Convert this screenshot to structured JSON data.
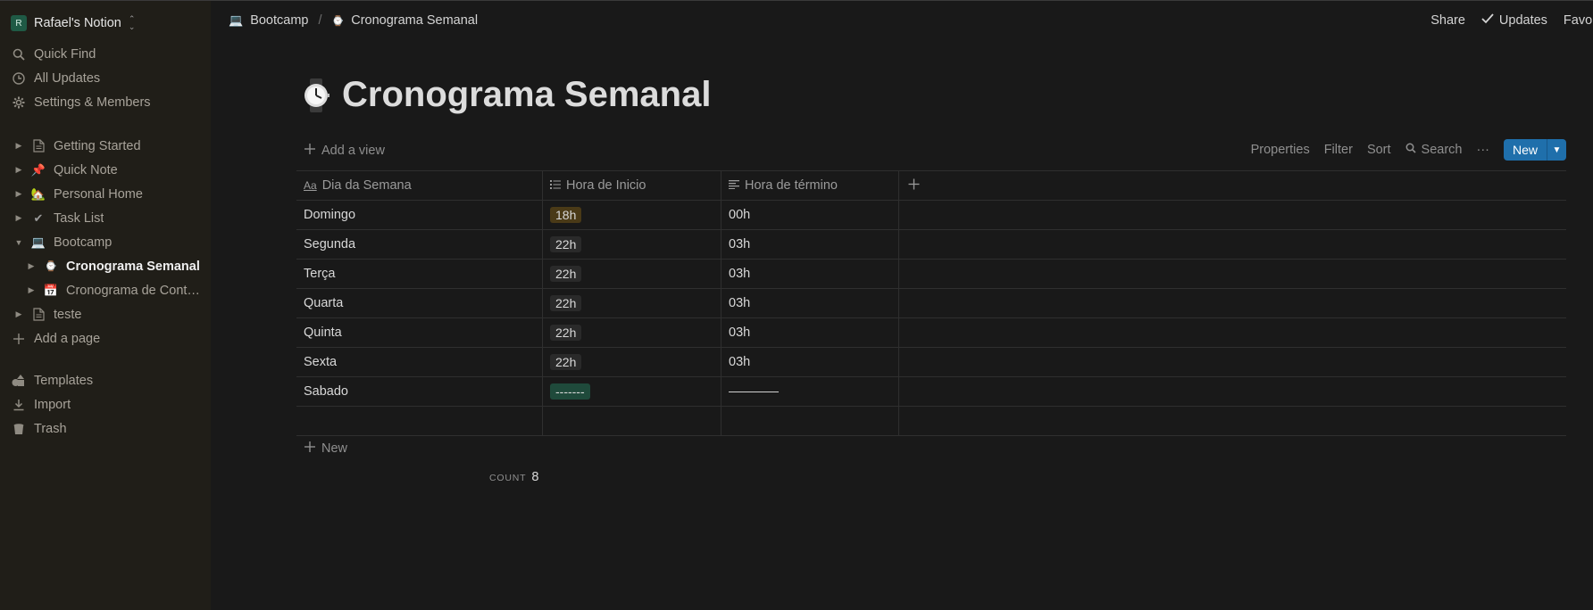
{
  "sidebar": {
    "workspace": {
      "avatar_letter": "R",
      "name": "Rafael's Notion"
    },
    "actions": [
      {
        "label": "Quick Find",
        "icon": "search-icon"
      },
      {
        "label": "All Updates",
        "icon": "clock-icon"
      },
      {
        "label": "Settings & Members",
        "icon": "gear-icon"
      }
    ],
    "pages": [
      {
        "label": "Getting Started",
        "icon": "document-icon",
        "icon_glyph": "",
        "expanded": false
      },
      {
        "label": "Quick Note",
        "icon": "pushpin-icon",
        "icon_glyph": "📌",
        "expanded": false
      },
      {
        "label": "Personal Home",
        "icon": "house-icon",
        "icon_glyph": "🏡",
        "expanded": false
      },
      {
        "label": "Task List",
        "icon": "checkmark-icon",
        "icon_glyph": "✔",
        "expanded": false
      },
      {
        "label": "Bootcamp",
        "icon": "laptop-icon",
        "icon_glyph": "💻",
        "expanded": true
      },
      {
        "label": "Cronograma Semanal",
        "icon": "watch-icon",
        "icon_glyph": "⌚",
        "active": true,
        "child": true
      },
      {
        "label": "Cronograma de Cont…",
        "icon": "calendar-icon",
        "icon_glyph": "📅",
        "child": true
      },
      {
        "label": "teste",
        "icon": "document-icon",
        "icon_glyph": "",
        "expanded": false
      }
    ],
    "add_page": "Add a page",
    "bottom": [
      {
        "label": "Templates",
        "icon": "shapes-icon"
      },
      {
        "label": "Import",
        "icon": "download-icon"
      },
      {
        "label": "Trash",
        "icon": "trash-icon"
      }
    ]
  },
  "topbar": {
    "breadcrumbs": [
      {
        "label": "Bootcamp",
        "icon_glyph": "💻"
      },
      {
        "label": "Cronograma Semanal",
        "icon_glyph": "⌚"
      }
    ],
    "separator": "/",
    "share": "Share",
    "updates": "Updates",
    "favorite": "Favor"
  },
  "page": {
    "title": "Cronograma Semanal",
    "add_view": "Add a view",
    "toolbar": {
      "properties": "Properties",
      "filter": "Filter",
      "sort": "Sort",
      "search": "Search",
      "more": "···",
      "new": "New"
    },
    "columns": [
      {
        "label": "Dia da Semana",
        "icon": "text-aa-icon"
      },
      {
        "label": "Hora de Inicio",
        "icon": "list-icon"
      },
      {
        "label": "Hora de término",
        "icon": "text-lines-icon"
      }
    ],
    "rows": [
      {
        "dia": "Domingo",
        "inicio": "18h",
        "inicio_color": "brown",
        "termino": "00h"
      },
      {
        "dia": "Segunda",
        "inicio": "22h",
        "inicio_color": "default",
        "termino": "03h"
      },
      {
        "dia": "Terça",
        "inicio": "22h",
        "inicio_color": "default",
        "termino": "03h"
      },
      {
        "dia": "Quarta",
        "inicio": "22h",
        "inicio_color": "default",
        "termino": "03h"
      },
      {
        "dia": "Quinta",
        "inicio": "22h",
        "inicio_color": "default",
        "termino": "03h"
      },
      {
        "dia": "Sexta",
        "inicio": "22h",
        "inicio_color": "default",
        "termino": "03h"
      },
      {
        "dia": "Sabado",
        "inicio": "-------",
        "inicio_color": "green",
        "termino": ""
      },
      {
        "dia": "",
        "inicio": "",
        "inicio_color": "",
        "termino": ""
      }
    ],
    "add_row": "New",
    "footer": {
      "count_label": "COUNT",
      "count_value": "8"
    }
  },
  "colors": {
    "accent_blue": "#1f6fab",
    "tag_brown": "#4a3a17",
    "tag_green": "#1f4a3b",
    "tag_default": "#2a2a2a"
  }
}
